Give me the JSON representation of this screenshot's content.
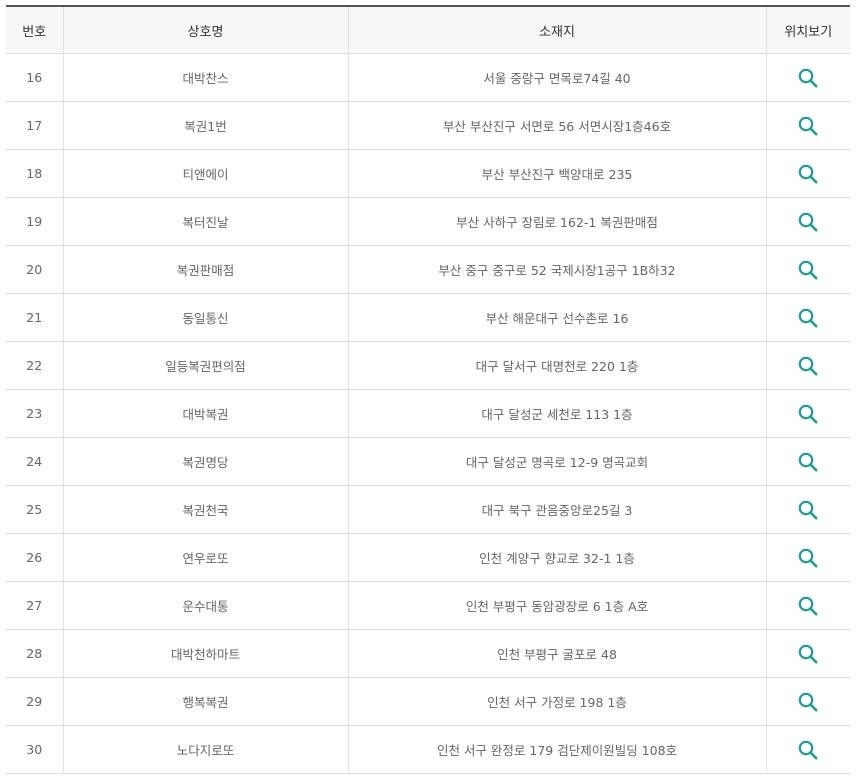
{
  "table": {
    "headers": {
      "number": "번호",
      "name": "상호명",
      "address": "소재지",
      "location": "위치보기"
    },
    "rows": [
      {
        "no": "16",
        "name": "대박찬스",
        "address": "서울 중랑구 면목로74길 40"
      },
      {
        "no": "17",
        "name": "복권1번",
        "address": "부산 부산진구 서면로 56 서면시장1층46호"
      },
      {
        "no": "18",
        "name": "티앤에이",
        "address": "부산 부산진구 백양대로 235"
      },
      {
        "no": "19",
        "name": "복터진날",
        "address": "부산 사하구 장림로 162-1 복권판매점"
      },
      {
        "no": "20",
        "name": "복권판매점",
        "address": "부산 중구 중구로 52 국제시장1공구 1B하32"
      },
      {
        "no": "21",
        "name": "동일통신",
        "address": "부산 해운대구 선수촌로 16"
      },
      {
        "no": "22",
        "name": "일등복권편의점",
        "address": "대구 달서구 대명천로 220 1층"
      },
      {
        "no": "23",
        "name": "대박복권",
        "address": "대구 달성군 세천로 113 1층"
      },
      {
        "no": "24",
        "name": "복권명당",
        "address": "대구 달성군 명곡로 12-9 명곡교회"
      },
      {
        "no": "25",
        "name": "복권천국",
        "address": "대구 북구 관음중앙로25길 3"
      },
      {
        "no": "26",
        "name": "연우로또",
        "address": "인천 계양구 향교로 32-1 1층"
      },
      {
        "no": "27",
        "name": "운수대통",
        "address": "인천 부평구 동암광장로 6 1층 A호"
      },
      {
        "no": "28",
        "name": "대박천하마트",
        "address": "인천 부평구 굴포로 48"
      },
      {
        "no": "29",
        "name": "행복복권",
        "address": "인천 서구 가정로 198 1층"
      },
      {
        "no": "30",
        "name": "노다지로또",
        "address": "인천 서구 완정로 179 검단제이원빌딩 108호"
      }
    ],
    "icon": "search-icon",
    "icon_color": "#1a9e96"
  }
}
